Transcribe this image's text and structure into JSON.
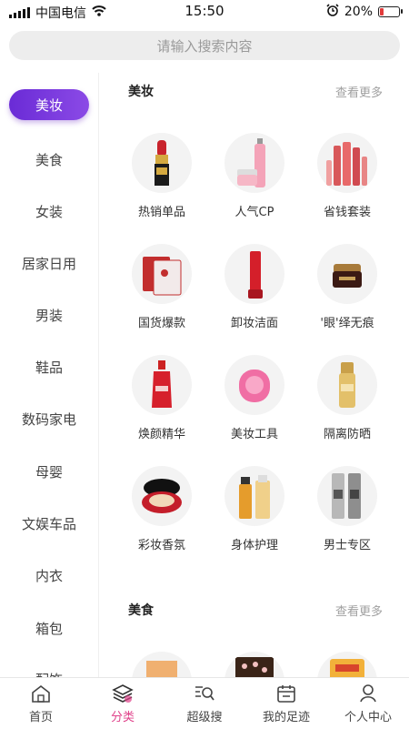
{
  "status": {
    "carrier": "中国电信",
    "time": "15:50",
    "battery": "20%",
    "battery_level": 0.2
  },
  "search": {
    "placeholder": "请输入搜索内容"
  },
  "sidebar": {
    "items": [
      "美妆",
      "美食",
      "女装",
      "居家日用",
      "男装",
      "鞋品",
      "数码家电",
      "母婴",
      "文娱车品",
      "内衣",
      "箱包",
      "配饰"
    ]
  },
  "sections": [
    {
      "title": "美妆",
      "more": "查看更多",
      "items": [
        "热销单品",
        "人气CP",
        "省钱套装",
        "国货爆款",
        "卸妆洁面",
        "'眼'绎无痕",
        "焕颜精华",
        "美妆工具",
        "隔离防晒",
        "彩妆香氛",
        "身体护理",
        "男士专区"
      ]
    },
    {
      "title": "美食",
      "more": "查看更多",
      "items": []
    }
  ],
  "tabbar": {
    "items": [
      "首页",
      "分类",
      "超级搜",
      "我的足迹",
      "个人中心"
    ],
    "active": 1
  },
  "colors": {
    "accent_purple": "#6a2bd6",
    "accent_pink": "#e0418a"
  }
}
